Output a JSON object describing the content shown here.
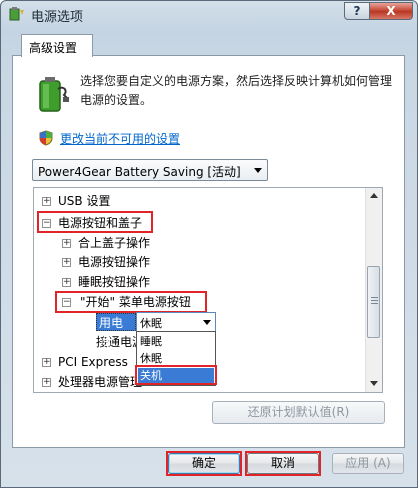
{
  "window": {
    "title": "电源选项"
  },
  "titlebar": {
    "help_label": "?",
    "close_label": "X"
  },
  "tabs": [
    {
      "label": "高级设置"
    }
  ],
  "intro_text": "选择您要自定义的电源方案，然后选择反映计算机如何管理电源的设置。",
  "change_link": "更改当前不可用的设置",
  "plan_select": {
    "value": "Power4Gear Battery Saving [活动]"
  },
  "tree": {
    "usb": "USB 设置",
    "power_buttons": "电源按钮和盖子",
    "lid_action": "合上盖子操作",
    "power_button_action": "电源按钮操作",
    "sleep_button_action": "睡眠按钮操作",
    "start_menu_button": "\"开始\" 菜单电源按钮",
    "on_battery": "用电池:",
    "plugged_in": "接通电源",
    "pci": "PCI Express",
    "cpu": "处理器电源管理"
  },
  "combo": {
    "value": "休眠",
    "options": [
      {
        "label": "睡眠"
      },
      {
        "label": "休眠"
      },
      {
        "label": "关机",
        "selected": true
      }
    ]
  },
  "restore_button": "还原计划默认值(R)",
  "buttons": {
    "ok": "确定",
    "cancel": "取消",
    "apply": "应用 (A)"
  },
  "colors": {
    "highlight_red": "#e0242a",
    "link": "#0066cc",
    "selection": "#3a7bd5"
  }
}
